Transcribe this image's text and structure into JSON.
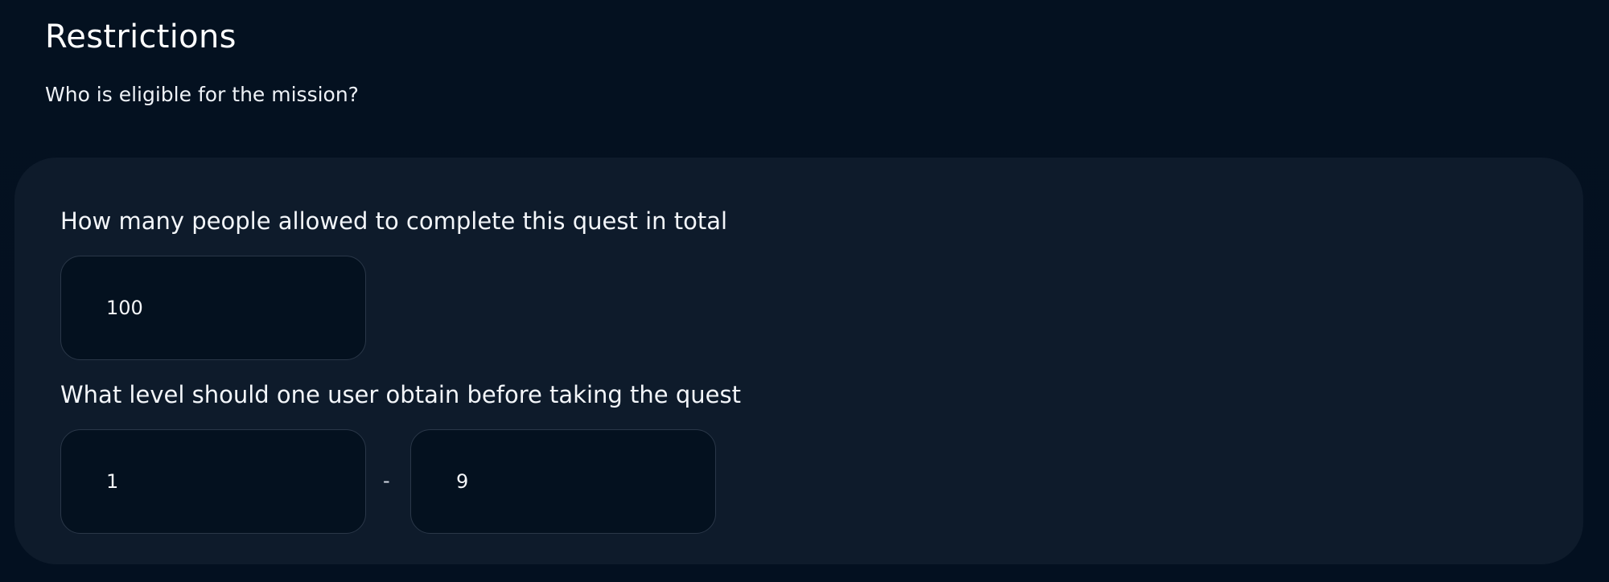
{
  "header": {
    "title": "Restrictions",
    "subtitle": "Who is eligible for the mission?"
  },
  "restrictions": {
    "total_completions": {
      "label": "How many people allowed to complete this quest in total",
      "value": "100"
    },
    "level_requirement": {
      "label": "What level should one user obtain before taking the quest",
      "min_value": "1",
      "separator": "-",
      "max_value": "9"
    }
  },
  "colors": {
    "background": "#041120",
    "panel": "#0e1b2b",
    "input_background": "#04111f",
    "input_border": "#2a3748",
    "text": "#f2f5f9"
  }
}
